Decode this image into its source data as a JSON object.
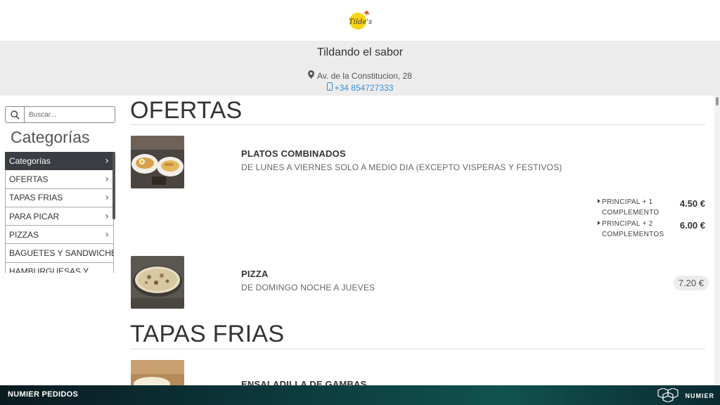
{
  "restaurant": {
    "logo_text": "Tilde's",
    "name": "Tildando el sabor",
    "address": "Av. de la Constitucion, 28",
    "phone": "+34 854727333"
  },
  "sidebar": {
    "search_placeholder": "Buscar...",
    "heading": "Categorías",
    "items": [
      {
        "label": "Categorías",
        "icon": "chevron-right-icon"
      },
      {
        "label": "OFERTAS",
        "icon": "chevron-right-icon"
      },
      {
        "label": "TAPAS FRIAS",
        "icon": "chevron-right-icon"
      },
      {
        "label": "PARA PICAR",
        "icon": "chevron-right-icon"
      },
      {
        "label": "PIZZAS",
        "icon": "chevron-right-icon"
      },
      {
        "label": "BAGUETES Y SANDWICHES"
      },
      {
        "label": "HAMBURGUESAS Y"
      }
    ]
  },
  "sections": [
    {
      "title": "OFERTAS",
      "products": [
        {
          "name": "PLATOS COMBINADOS",
          "description": "DE LUNES A VIERNES SOLO A MEDIO DIA (EXCEPTO VISPERAS Y FESTIVOS)",
          "options": [
            {
              "line1": "PRINCIPAL + 1",
              "line2": "COMPLEMENTO",
              "price": "4.50 €"
            },
            {
              "line1": "PRINCIPAL + 2",
              "line2": "COMPLEMENTOS",
              "price": "6.00 €"
            }
          ]
        },
        {
          "name": "PIZZA",
          "description": "DE DOMINGO NOCHE A JUEVES",
          "price": "7.20 €"
        }
      ]
    },
    {
      "title": "TAPAS FRIAS",
      "products": [
        {
          "name": "ENSALADILLA DE GAMBAS"
        }
      ]
    }
  ],
  "footer": {
    "left": "NUMIER PEDIDOS",
    "right": "NUMIER"
  },
  "colors": {
    "header_bg": "#ececec",
    "active_category_bg": "#3a3d42",
    "phone_link": "#3a8fd6",
    "footer_bg": "#0c3a3e"
  }
}
